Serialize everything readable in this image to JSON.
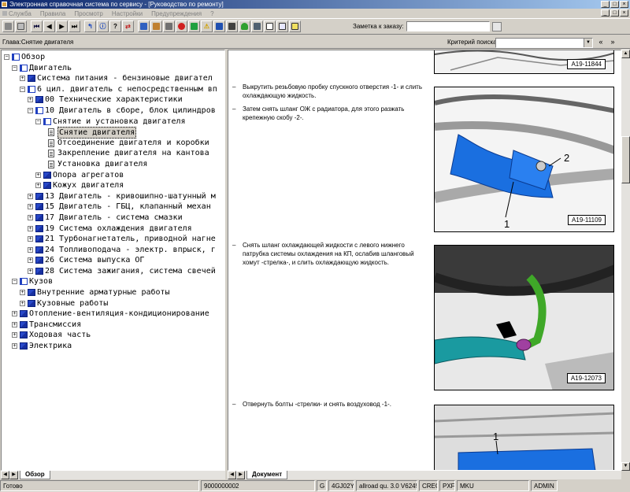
{
  "window": {
    "title": "Электронная справочная система по сервису - [Руководство по ремонту]",
    "min": "_",
    "max": "□",
    "close": "×"
  },
  "menu": [
    "Служба",
    "Правила",
    "Просмотр",
    "Настройки",
    "Предупреждения",
    "?"
  ],
  "toolbar": {
    "zametka_label": "Заметка к заказу:"
  },
  "addressbar": {
    "chapter": "Глава:Снятие двигателя"
  },
  "search": {
    "label": "Критерий поиска:",
    "prev": "«",
    "next": "»"
  },
  "tree": [
    {
      "level": 0,
      "toggle": "−",
      "icon": "open",
      "label": "Обзор"
    },
    {
      "level": 1,
      "toggle": "−",
      "icon": "open",
      "label": "Двигатель"
    },
    {
      "level": 2,
      "toggle": "+",
      "icon": "closed",
      "label": "Система питания - бензиновые двигател"
    },
    {
      "level": 2,
      "toggle": "−",
      "icon": "open",
      "label": "6 цил. двигатель с непосредственным вп"
    },
    {
      "level": 3,
      "toggle": "+",
      "icon": "closed",
      "label": "00 Технические характеристики"
    },
    {
      "level": 3,
      "toggle": "−",
      "icon": "open",
      "label": "10 Двигатель в сборе, блок цилиндров"
    },
    {
      "level": 4,
      "toggle": "−",
      "icon": "open",
      "label": "Снятие и установка двигателя"
    },
    {
      "level": 5,
      "toggle": "",
      "icon": "doc",
      "label": "Снятие двигателя",
      "selected": true
    },
    {
      "level": 5,
      "toggle": "",
      "icon": "doc",
      "label": "Отсоединение двигателя и коробки"
    },
    {
      "level": 5,
      "toggle": "",
      "icon": "doc",
      "label": "Закрепление двигателя на кантова"
    },
    {
      "level": 5,
      "toggle": "",
      "icon": "doc",
      "label": "Установка двигателя"
    },
    {
      "level": 4,
      "toggle": "+",
      "icon": "closed",
      "label": "Опора агрегатов"
    },
    {
      "level": 4,
      "toggle": "+",
      "icon": "closed",
      "label": "Кожух двигателя"
    },
    {
      "level": 3,
      "toggle": "+",
      "icon": "closed",
      "label": "13 Двигатель - кривошипно-шатунный м"
    },
    {
      "level": 3,
      "toggle": "+",
      "icon": "closed",
      "label": "15 Двигатель - ГБЦ, клапанный механ"
    },
    {
      "level": 3,
      "toggle": "+",
      "icon": "closed",
      "label": "17 Двигатель - система смазки"
    },
    {
      "level": 3,
      "toggle": "+",
      "icon": "closed",
      "label": "19 Система охлаждения двигателя"
    },
    {
      "level": 3,
      "toggle": "+",
      "icon": "closed",
      "label": "21 Турбонагнетатель, приводной нагне"
    },
    {
      "level": 3,
      "toggle": "+",
      "icon": "closed",
      "label": "24 Топливоподача - электр. впрыск, г"
    },
    {
      "level": 3,
      "toggle": "+",
      "icon": "closed",
      "label": "26 Система выпуска ОГ"
    },
    {
      "level": 3,
      "toggle": "+",
      "icon": "closed",
      "label": "28 Система зажигания, система свечей"
    },
    {
      "level": 1,
      "toggle": "−",
      "icon": "open",
      "label": "Кузов"
    },
    {
      "level": 2,
      "toggle": "+",
      "icon": "closed",
      "label": "Внутренние арматурные работы"
    },
    {
      "level": 2,
      "toggle": "+",
      "icon": "closed",
      "label": "Кузовные работы"
    },
    {
      "level": 1,
      "toggle": "+",
      "icon": "closed",
      "label": "Отопление-вентиляция-кондиционирование"
    },
    {
      "level": 1,
      "toggle": "+",
      "icon": "closed",
      "label": "Трансмиссия"
    },
    {
      "level": 1,
      "toggle": "+",
      "icon": "closed",
      "label": "Ходовая часть"
    },
    {
      "level": 1,
      "toggle": "+",
      "icon": "closed",
      "label": "Электрика"
    }
  ],
  "left_tab": "Обзор",
  "doc_tab": "Документ",
  "doc": {
    "steps": [
      "Выкрутить резьбовую пробку спускного отверстия -1- и слить охлаждающую жидкость.",
      "Затем снять шланг ОЖ с радиатора, для этого разжать крепежную скобу -2-.",
      "Снять шланг охлаждающей жидкости с левого нижнего патрубка системы охлаждения на КП, ослабив шланговый хомут -стрелка-, и слить охлаждающую жидкость.",
      "Отвернуть болты -стрелки- и снять воздуховод -1-."
    ],
    "dash": "–",
    "figures": [
      "A19-11844",
      "A19-11109",
      "A19-12073"
    ],
    "callouts": {
      "one": "1",
      "two": "2"
    }
  },
  "status": [
    "Готово",
    "9000000002",
    "G",
    "4GJ02Y",
    "allroad qu. 3.0 V6245",
    "CREC",
    "PXF",
    "MKU",
    "ADMIN"
  ],
  "colors": {
    "title_start": "#0a246a",
    "title_end": "#a6caf0",
    "part_blue": "#1a6fe0",
    "hose_green": "#3fa828",
    "clamp_magenta": "#a040a0"
  }
}
